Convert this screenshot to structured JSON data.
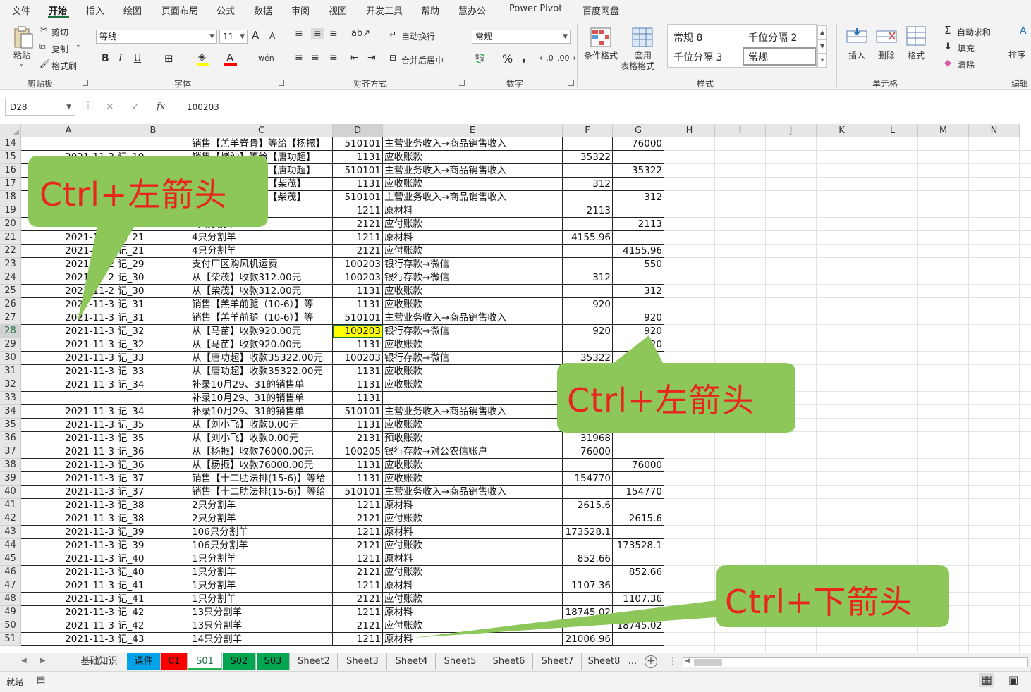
{
  "menu": [
    "文件",
    "开始",
    "插入",
    "绘图",
    "页面布局",
    "公式",
    "数据",
    "审阅",
    "视图",
    "开发工具",
    "帮助",
    "慧办公",
    "Power Pivot",
    "百度网盘"
  ],
  "ribbon": {
    "clipboard": {
      "paste": "粘贴",
      "cut": "剪切",
      "copy": "复制",
      "format_painter": "格式刷",
      "label": "剪贴板"
    },
    "font": {
      "name": "等线",
      "size": "11",
      "label": "字体",
      "bold": "B",
      "italic": "I",
      "underline": "U",
      "grow": "A",
      "shrink": "A"
    },
    "align": {
      "wrap": "自动换行",
      "merge": "合并后居中",
      "label": "对齐方式"
    },
    "number": {
      "format": "常规",
      "percent": "%",
      "comma": ",",
      "label": "数字"
    },
    "styles": {
      "conditional": "条件格式",
      "table1": "套用",
      "table2": "表格格式",
      "items": [
        "常规 8",
        "千位分隔 2",
        "千位分隔 3",
        "常规"
      ],
      "label": "样式"
    },
    "cells": {
      "insert": "插入",
      "delete": "删除",
      "format": "格式",
      "label": "单元格"
    },
    "editing": {
      "autosum": "自动求和",
      "fill": "填充",
      "clear": "清除",
      "sort": "排序",
      "label": "编辑"
    }
  },
  "formula": {
    "namebox": "D28",
    "fx": "fx",
    "value": "100203"
  },
  "columns": [
    "A",
    "B",
    "C",
    "D",
    "E",
    "F",
    "G",
    "H",
    "I",
    "J",
    "K",
    "L",
    "M",
    "N"
  ],
  "rows": [
    {
      "n": "14",
      "a": "",
      "b": "",
      "c": "销售【羔羊脊骨】等给【杨振】",
      "d": "510101",
      "e": "主营业务收入→商品销售收入",
      "f": "",
      "g": "76000"
    },
    {
      "n": "15",
      "a": "2021-11-3",
      "b": "记_19",
      "c": "销售【烤油】等给【唐功超】",
      "d": "1131",
      "e": "应收账款",
      "f": "35322",
      "g": ""
    },
    {
      "n": "16",
      "a": "",
      "b": "",
      "c": "销售【烤油】等给【唐功超】",
      "d": "510101",
      "e": "主营业务收入→商品销售收入",
      "f": "",
      "g": "35322"
    },
    {
      "n": "17",
      "a": "",
      "b": "",
      "c": "销售【羊排】等给【柴茂】",
      "d": "1131",
      "e": "应收账款",
      "f": "312",
      "g": ""
    },
    {
      "n": "18",
      "a": "",
      "b": "",
      "c": "销售【羊排】等给【柴茂】",
      "d": "510101",
      "e": "主营业务收入→商品销售收入",
      "f": "",
      "g": "312"
    },
    {
      "n": "19",
      "a": "",
      "b": "",
      "c": "",
      "d": "1211",
      "e": "原材料",
      "f": "2113",
      "g": ""
    },
    {
      "n": "20",
      "a": "2021-11-2",
      "b": "记_20",
      "c": "1只分割羊",
      "d": "2121",
      "e": "应付账款",
      "f": "",
      "g": "2113"
    },
    {
      "n": "21",
      "a": "2021-11-2",
      "b": "记_21",
      "c": "4只分割羊",
      "d": "1211",
      "e": "原材料",
      "f": "4155.96",
      "g": ""
    },
    {
      "n": "22",
      "a": "2021-11-2",
      "b": "记_21",
      "c": "4只分割羊",
      "d": "2121",
      "e": "应付账款",
      "f": "",
      "g": "4155.96"
    },
    {
      "n": "23",
      "a": "2021-11-2",
      "b": "记_29",
      "c": "支付厂区购风机运费",
      "d": "100203",
      "e": "银行存款→微信",
      "f": "",
      "g": "550"
    },
    {
      "n": "24",
      "a": "2021-11-2",
      "b": "记_30",
      "c": "从【柴茂】收款312.00元",
      "d": "100203",
      "e": "银行存款→微信",
      "f": "312",
      "g": ""
    },
    {
      "n": "25",
      "a": "2021-11-2",
      "b": "记_30",
      "c": "从【柴茂】收款312.00元",
      "d": "1131",
      "e": "应收账款",
      "f": "",
      "g": "312"
    },
    {
      "n": "26",
      "a": "2021-11-3",
      "b": "记_31",
      "c": "销售【羔羊前腿（10-6）】等",
      "d": "1131",
      "e": "应收账款",
      "f": "920",
      "g": ""
    },
    {
      "n": "27",
      "a": "2021-11-3",
      "b": "记_31",
      "c": "销售【羔羊前腿（10-6）】等",
      "d": "510101",
      "e": "主营业务收入→商品销售收入",
      "f": "",
      "g": "920"
    },
    {
      "n": "28",
      "a": "2021-11-3",
      "b": "记_32",
      "c": "从【马苗】收款920.00元",
      "d": "100203",
      "e": "银行存款→微信",
      "f": "920",
      "g": "920"
    },
    {
      "n": "29",
      "a": "2021-11-3",
      "b": "记_32",
      "c": "从【马苗】收款920.00元",
      "d": "1131",
      "e": "应收账款",
      "f": "",
      "g": "920"
    },
    {
      "n": "30",
      "a": "2021-11-3",
      "b": "记_33",
      "c": "从【唐功超】收款35322.00元",
      "d": "100203",
      "e": "银行存款→微信",
      "f": "35322",
      "g": ""
    },
    {
      "n": "31",
      "a": "2021-11-3",
      "b": "记_33",
      "c": "从【唐功超】收款35322.00元",
      "d": "1131",
      "e": "应收账款",
      "f": "",
      "g": ""
    },
    {
      "n": "32",
      "a": "2021-11-3",
      "b": "记_34",
      "c": "补录10月29、31的销售单",
      "d": "1131",
      "e": "应收账款",
      "f": "",
      "g": ""
    },
    {
      "n": "33",
      "a": "",
      "b": "",
      "c": "补录10月29、31的销售单",
      "d": "1131",
      "e": "",
      "f": "",
      "g": ""
    },
    {
      "n": "34",
      "a": "2021-11-3",
      "b": "记_34",
      "c": "补录10月29、31的销售单",
      "d": "510101",
      "e": "主营业务收入→商品销售收入",
      "f": "",
      "g": ""
    },
    {
      "n": "35",
      "a": "2021-11-3",
      "b": "记_35",
      "c": "从【刘小飞】收款0.00元",
      "d": "1131",
      "e": "应收账款",
      "f": "",
      "g": ""
    },
    {
      "n": "36",
      "a": "2021-11-3",
      "b": "记_35",
      "c": "从【刘小飞】收款0.00元",
      "d": "2131",
      "e": "预收账款",
      "f": "31968",
      "g": ""
    },
    {
      "n": "37",
      "a": "2021-11-3",
      "b": "记_36",
      "c": "从【杨振】收款76000.00元",
      "d": "100205",
      "e": "银行存款→对公农信账户",
      "f": "76000",
      "g": ""
    },
    {
      "n": "38",
      "a": "2021-11-3",
      "b": "记_36",
      "c": "从【杨振】收款76000.00元",
      "d": "1131",
      "e": "应收账款",
      "f": "",
      "g": "76000"
    },
    {
      "n": "39",
      "a": "2021-11-3",
      "b": "记_37",
      "c": "销售【十二肋法排(15-6)】等给",
      "d": "1131",
      "e": "应收账款",
      "f": "154770",
      "g": ""
    },
    {
      "n": "40",
      "a": "2021-11-3",
      "b": "记_37",
      "c": "销售【十二肋法排(15-6)】等给",
      "d": "510101",
      "e": "主营业务收入→商品销售收入",
      "f": "",
      "g": "154770"
    },
    {
      "n": "41",
      "a": "2021-11-3",
      "b": "记_38",
      "c": "2只分割羊",
      "d": "1211",
      "e": "原材料",
      "f": "2615.6",
      "g": ""
    },
    {
      "n": "42",
      "a": "2021-11-3",
      "b": "记_38",
      "c": "2只分割羊",
      "d": "2121",
      "e": "应付账款",
      "f": "",
      "g": "2615.6"
    },
    {
      "n": "43",
      "a": "2021-11-3",
      "b": "记_39",
      "c": "106只分割羊",
      "d": "1211",
      "e": "原材料",
      "f": "173528.1",
      "g": ""
    },
    {
      "n": "44",
      "a": "2021-11-3",
      "b": "记_39",
      "c": "106只分割羊",
      "d": "2121",
      "e": "应付账款",
      "f": "",
      "g": "173528.1"
    },
    {
      "n": "45",
      "a": "2021-11-3",
      "b": "记_40",
      "c": "1只分割羊",
      "d": "1211",
      "e": "原材料",
      "f": "852.66",
      "g": ""
    },
    {
      "n": "46",
      "a": "2021-11-3",
      "b": "记_40",
      "c": "1只分割羊",
      "d": "2121",
      "e": "应付账款",
      "f": "",
      "g": "852.66"
    },
    {
      "n": "47",
      "a": "2021-11-3",
      "b": "记_41",
      "c": "1只分割羊",
      "d": "1211",
      "e": "原材料",
      "f": "1107.36",
      "g": ""
    },
    {
      "n": "48",
      "a": "2021-11-3",
      "b": "记_41",
      "c": "1只分割羊",
      "d": "2121",
      "e": "应付账款",
      "f": "",
      "g": "1107.36"
    },
    {
      "n": "49",
      "a": "2021-11-3",
      "b": "记_42",
      "c": "13只分割羊",
      "d": "1211",
      "e": "原材料",
      "f": "18745.02",
      "g": ""
    },
    {
      "n": "50",
      "a": "2021-11-3",
      "b": "记_42",
      "c": "13只分割羊",
      "d": "2121",
      "e": "应付账款",
      "f": "",
      "g": "18745.02"
    },
    {
      "n": "51",
      "a": "2021-11-3",
      "b": "记_43",
      "c": "14只分割羊",
      "d": "1211",
      "e": "原材料",
      "f": "21006.96",
      "g": ""
    }
  ],
  "callouts": [
    {
      "text": "Ctrl+左箭头"
    },
    {
      "text": "Ctrl+左箭头"
    },
    {
      "text": "Ctrl+下箭头"
    }
  ],
  "sheet_tabs": [
    {
      "label": "基础知识",
      "color": ""
    },
    {
      "label": "课件",
      "color": "#00a2e8"
    },
    {
      "label": "01",
      "color": "#ff0000"
    },
    {
      "label": "S01",
      "color": "#22b14c",
      "active": true
    },
    {
      "label": "S02",
      "color": "#00a651"
    },
    {
      "label": "S03",
      "color": "#00a651"
    },
    {
      "label": "Sheet2",
      "color": ""
    },
    {
      "label": "Sheet3",
      "color": ""
    },
    {
      "label": "Sheet4",
      "color": ""
    },
    {
      "label": "Sheet5",
      "color": ""
    },
    {
      "label": "Sheet6",
      "color": ""
    },
    {
      "label": "Sheet7",
      "color": ""
    },
    {
      "label": "Sheet8",
      "color": ""
    }
  ],
  "tabs_more": "...",
  "status": "就绪",
  "colors": {
    "accent": "#1f7244",
    "callout": "#8dc75a",
    "callout_text": "#e8261e",
    "selected_cell": "#ffff00"
  }
}
